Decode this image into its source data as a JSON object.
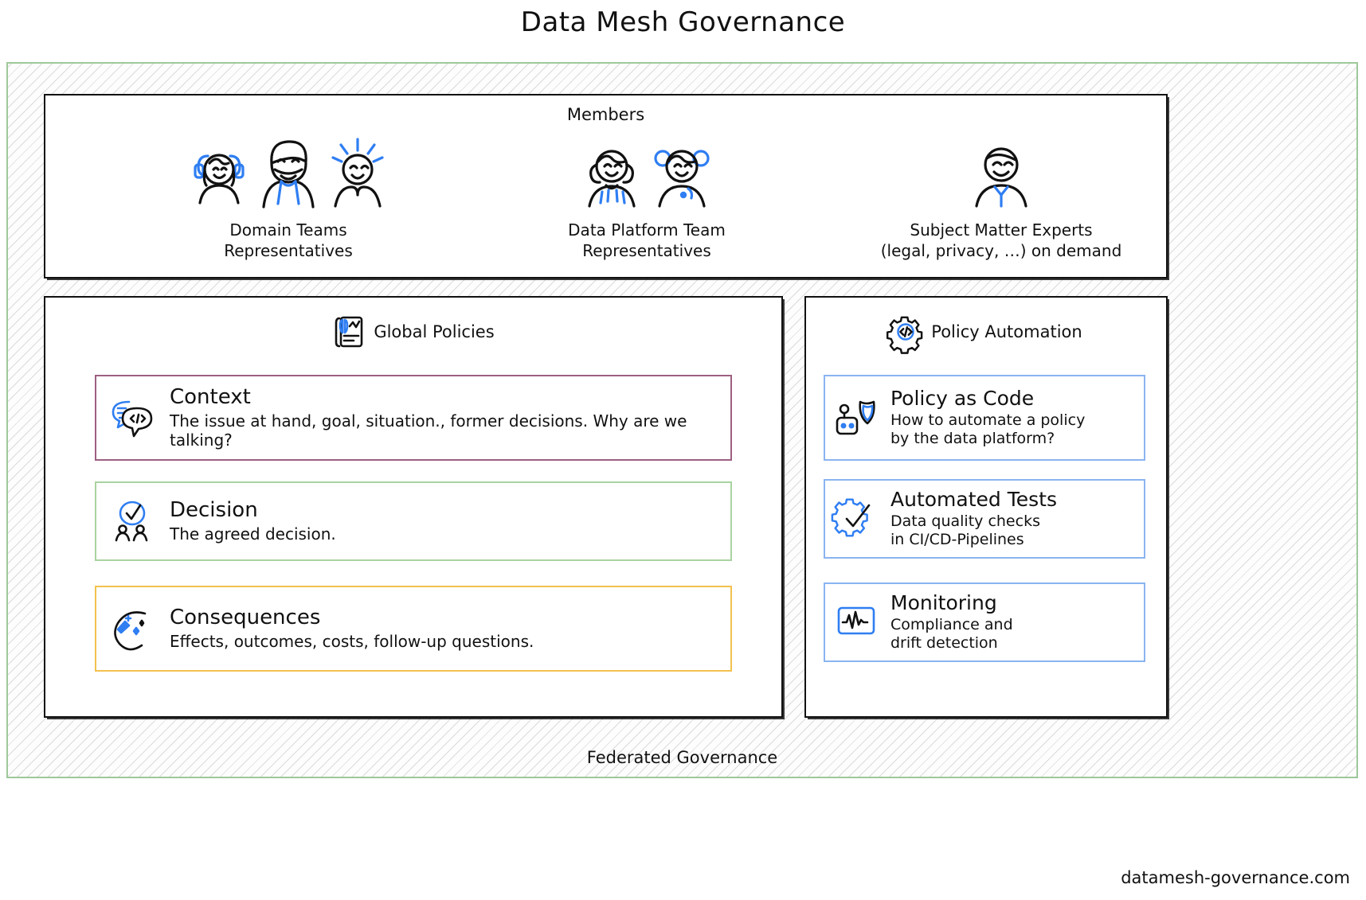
{
  "title": "Data Mesh Governance",
  "outer": {
    "footer_label": "Federated Governance",
    "border_color": "#9ec89a"
  },
  "watermark": "datamesh-governance.com",
  "members": {
    "title": "Members",
    "groups": [
      {
        "id": "domain-teams",
        "label": "Domain Teams\nRepresentatives",
        "icon": "three-people-icon",
        "count": 3
      },
      {
        "id": "data-platform-team",
        "label": "Data Platform Team\nRepresentatives",
        "icon": "two-people-icon",
        "count": 2
      },
      {
        "id": "subject-matter-experts",
        "label": "Subject Matter Experts\n(legal, privacy, …) on demand",
        "icon": "person-icon",
        "count": 1
      }
    ]
  },
  "global_policies": {
    "title": "Global Policies",
    "icon": "document-chart-icon",
    "cards": [
      {
        "id": "context",
        "title": "Context",
        "description": "The issue at hand, goal, situation., former decisions. Why are we talking?",
        "icon": "speech-bubble-code-icon",
        "border_color": "#9d5f81"
      },
      {
        "id": "decision",
        "title": "Decision",
        "description": "The agreed decision.",
        "icon": "checkmark-people-icon",
        "border_color": "#a8d3a0"
      },
      {
        "id": "consequences",
        "title": "Consequences",
        "description": "Effects, outcomes, costs, follow-up questions.",
        "icon": "magic-wand-sparkle-icon",
        "border_color": "#f2c14e"
      }
    ]
  },
  "policy_automation": {
    "title": "Policy Automation",
    "icon": "gear-code-icon",
    "cards": [
      {
        "id": "policy-as-code",
        "title": "Policy as Code",
        "description": "How to automate a policy\nby the data platform?",
        "icon": "robot-shield-icon",
        "border_color": "#8ab4f0"
      },
      {
        "id": "automated-tests",
        "title": "Automated Tests",
        "description": "Data quality checks\nin CI/CD-Pipelines",
        "icon": "gear-check-icon",
        "border_color": "#8ab4f0"
      },
      {
        "id": "monitoring",
        "title": "Monitoring",
        "description": "Compliance and\ndrift detection",
        "icon": "monitor-pulse-icon",
        "border_color": "#8ab4f0"
      }
    ]
  },
  "colors": {
    "accent_blue": "#2f7ef2",
    "ink": "#111111",
    "green": "#9ec89a",
    "mauve": "#9d5f81",
    "yellow": "#f2c14e"
  }
}
